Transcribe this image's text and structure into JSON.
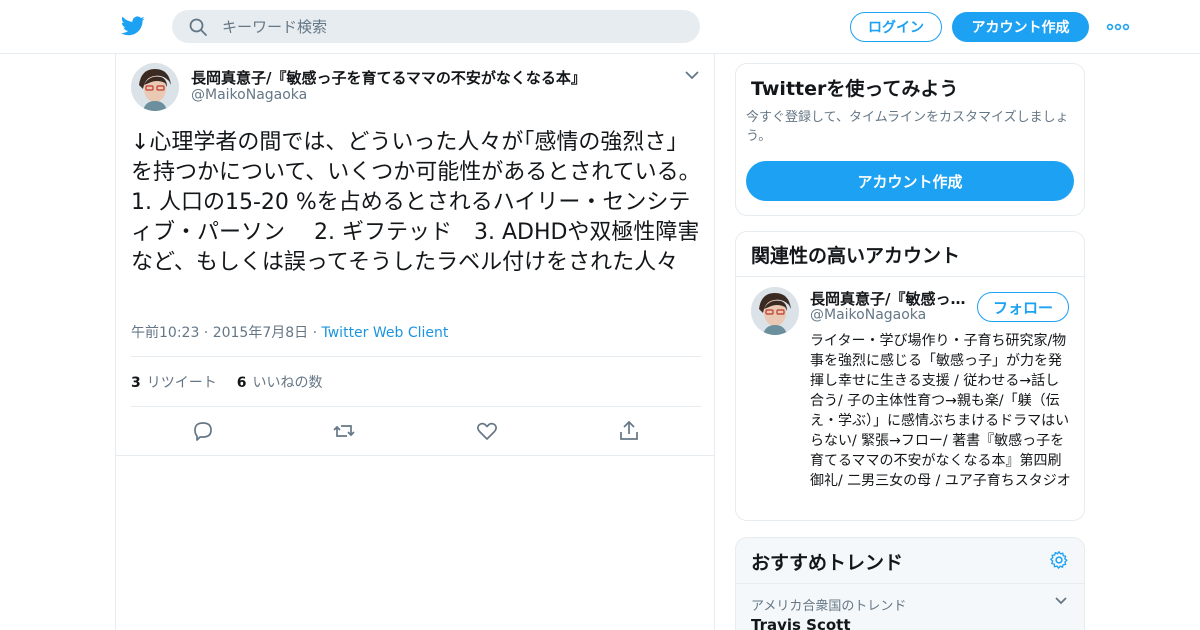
{
  "colors": {
    "brand": "#1da1f2",
    "link": "#1b95e0",
    "muted": "#657786",
    "border": "#e6ecf0"
  },
  "header": {
    "search_placeholder": "キーワード検索",
    "login_label": "ログイン",
    "signup_label": "アカウント作成"
  },
  "tweet": {
    "author_name": "長岡真意子/『敏感っ子を育てるママの不安がなくなる本』",
    "author_handle": "@MaikoNagaoka",
    "text": "↓心理学者の間では、どういった人々が｢感情の強烈さ」を持つかについて、いくつか可能性があるとされている。1. 人口の15-20 %を占めるとされるハイリー・センシティブ・パーソン　 2. ギフテッド　3. ADHDや双極性障害など、もしくは誤ってそうしたラベル付けをされた人々",
    "timestamp": "午前10:23 · 2015年7月8日",
    "separator": "·",
    "client": "Twitter Web Client",
    "retweet_count": "3",
    "retweet_label": "リツイート",
    "like_count": "6",
    "like_label": "いいねの数"
  },
  "sidebar": {
    "signup_card": {
      "title": "Twitterを使ってみよう",
      "description": "今すぐ登録して、タイムラインをカスタマイズしましょう。",
      "button": "アカウント作成"
    },
    "related": {
      "title": "関連性の高いアカウント",
      "account": {
        "name": "長岡真意子/『敏感っ子を育てるママの不安がなくなる本』",
        "handle": "@MaikoNagaoka",
        "follow_label": "フォロー",
        "bio": "ライター・学び場作り・子育ち研究家/物事を強烈に感じる「敏感っ子」が力を発揮し幸せに生きる支援 / 従わせる→話し合う/ 子の主体性育つ→親も楽/「躾（伝え・学ぶ）」に感情ぶちまけるドラマはいらない/ 緊張→フロー/ 著書『敏感っ子を育てるママの不安がなくなる本』第四刷御礼/ 二男三女の母 / ユア子育ちスタジオ"
      }
    },
    "trends": {
      "title": "おすすめトレンド",
      "items": [
        {
          "location": "アメリカ合衆国のトレンド",
          "name": "Travis Scott"
        }
      ]
    }
  },
  "icons": [
    "twitter-bird-icon",
    "search-icon",
    "more-icon",
    "chevron-down-icon",
    "reply-icon",
    "retweet-icon",
    "like-icon",
    "share-icon",
    "gear-icon"
  ]
}
